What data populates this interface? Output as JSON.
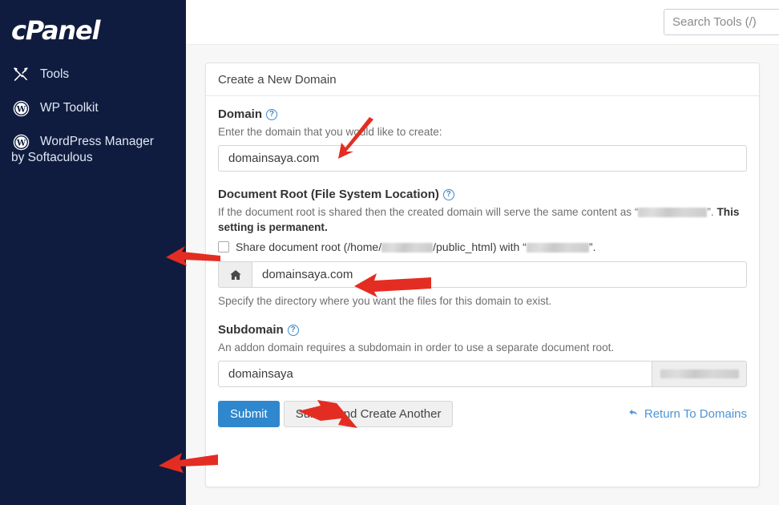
{
  "sidebar": {
    "brand": "cPanel",
    "items": [
      {
        "label": "Tools",
        "icon": "tools-icon"
      },
      {
        "label": "WP Toolkit",
        "icon": "wordpress-icon"
      },
      {
        "label": "WordPress Manager",
        "sublabel": "by Softaculous",
        "icon": "wordpress-icon"
      }
    ]
  },
  "topbar": {
    "search_placeholder": "Search Tools (/)",
    "search_value": ""
  },
  "card": {
    "title": "Create a New Domain",
    "domain": {
      "label": "Domain",
      "help": "Enter the domain that you would like to create:",
      "value": "domainsaya.com",
      "placeholder": ""
    },
    "document_root": {
      "label": "Document Root (File System Location)",
      "help_prefix": "If the document root is shared then the created domain will serve the same content as “",
      "help_mid": "”. ",
      "help_bold": "This setting is permanent.",
      "checkbox_checked": false,
      "checkbox_part1": "Share document root (/home/",
      "checkbox_part2": "/public_html) with “",
      "checkbox_part3": "”.",
      "icon": "home-icon",
      "value": "domainsaya.com",
      "hint": "Specify the directory where you want the files for this domain to exist."
    },
    "subdomain": {
      "label": "Subdomain",
      "help": "An addon domain requires a subdomain in order to use a separate document root.",
      "value": "domainsaya",
      "suffix_redacted": true
    },
    "buttons": {
      "submit": "Submit",
      "submit_another": "Submit And Create Another",
      "return_link": "Return To Domains",
      "return_icon": "reply-arrow-icon"
    }
  },
  "annotations": {
    "arrow_color": "#e42d22",
    "arrows": [
      {
        "name": "arrow-to-domain-field"
      },
      {
        "name": "arrow-to-share-checkbox"
      },
      {
        "name": "arrow-to-document-root-field"
      },
      {
        "name": "arrow-to-subdomain-field"
      },
      {
        "name": "arrow-to-submit-button"
      }
    ]
  },
  "colors": {
    "sidebar_bg": "#101c3f",
    "primary": "#2f87cd",
    "link": "#4c94d6",
    "page_bg": "#f7f7f7"
  }
}
